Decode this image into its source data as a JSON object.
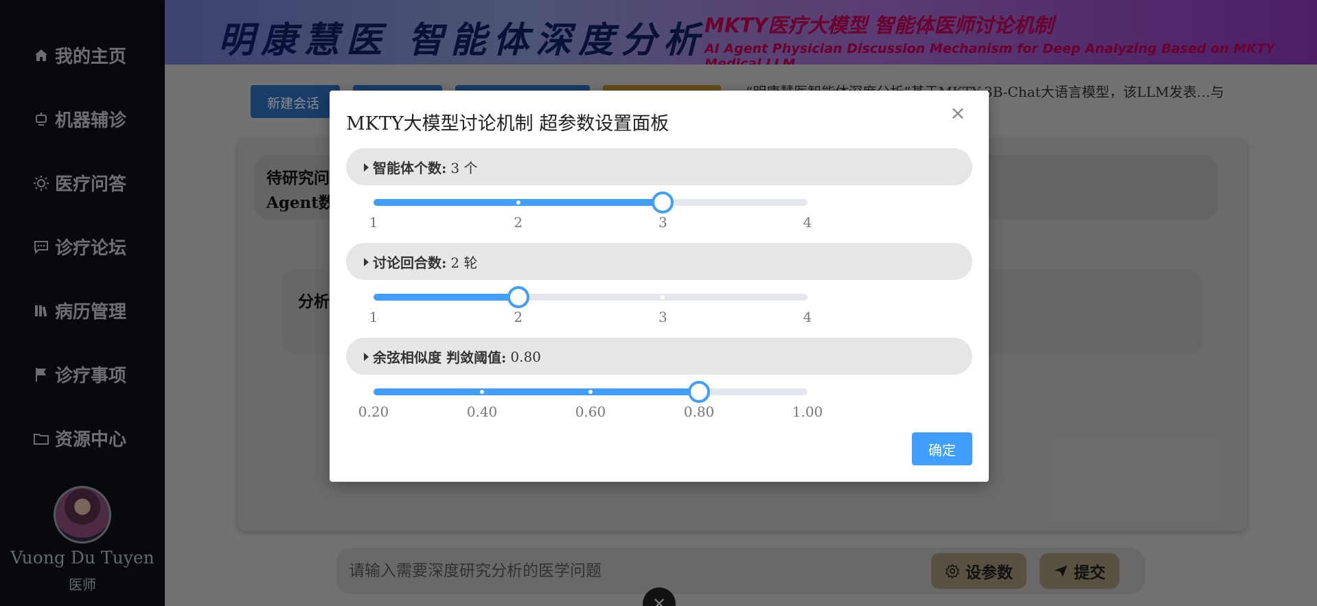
{
  "sidebar": {
    "items": [
      {
        "label": "我的主页",
        "icon": "home-icon"
      },
      {
        "label": "机器辅诊",
        "icon": "robot-icon"
      },
      {
        "label": "医疗问答",
        "icon": "sun-icon"
      },
      {
        "label": "诊疗论坛",
        "icon": "chat-icon"
      },
      {
        "label": "病历管理",
        "icon": "records-icon"
      },
      {
        "label": "诊疗事项",
        "icon": "flag-icon"
      },
      {
        "label": "资源中心",
        "icon": "folder-icon"
      }
    ],
    "user": {
      "name": "Vuong Du Tuyen",
      "role": "医师"
    }
  },
  "banner": {
    "title": "明康慧医 智能体深度分析",
    "subtitle": "MKTY医疗大模型 智能体医师讨论机制",
    "subtitle_en": "AI Agent Physician Discussion Mechanism for Deep Analyzing Based on MKTY Medical LLM"
  },
  "toolbar": {
    "new_chat_label": "新建会话",
    "buttons": [
      {
        "label": "",
        "color": "#2f6fbf"
      },
      {
        "label": "",
        "color": "#2f6fbf"
      },
      {
        "label": "",
        "color": "#b88a2a"
      }
    ]
  },
  "description": "“明康慧医智能体深度分析”基于MKTY-3B-Chat大语言模型，该LLM发表…与可靠性。",
  "question": {
    "label_line1": "待研究问",
    "label_line2": "Agent数"
  },
  "analysis": {
    "label": "分析"
  },
  "input": {
    "placeholder": "请输入需要深度研究分析的医学问题",
    "value": ""
  },
  "actions": {
    "settings_label": "设参数",
    "submit_label": "提交",
    "settings_icon": "gear-icon",
    "submit_icon": "send-icon"
  },
  "modal": {
    "title": "MKTY大模型讨论机制 超参数设置面板",
    "confirm_label": "确定",
    "accent": "#409eff",
    "sections": [
      {
        "label": "智能体个数:",
        "value_text": "3 个",
        "min": 1,
        "max": 4,
        "value": 3,
        "marks": [
          "1",
          "2",
          "3",
          "4"
        ]
      },
      {
        "label": "讨论回合数:",
        "value_text": "2 轮",
        "min": 1,
        "max": 4,
        "value": 2,
        "marks": [
          "1",
          "2",
          "3",
          "4"
        ]
      },
      {
        "label": "余弦相似度 判敛阈值:",
        "value_text": "0.80",
        "min": 0.2,
        "max": 1.0,
        "value": 0.8,
        "marks": [
          "0.20",
          "0.40",
          "0.60",
          "0.80",
          "1.00"
        ]
      }
    ]
  }
}
